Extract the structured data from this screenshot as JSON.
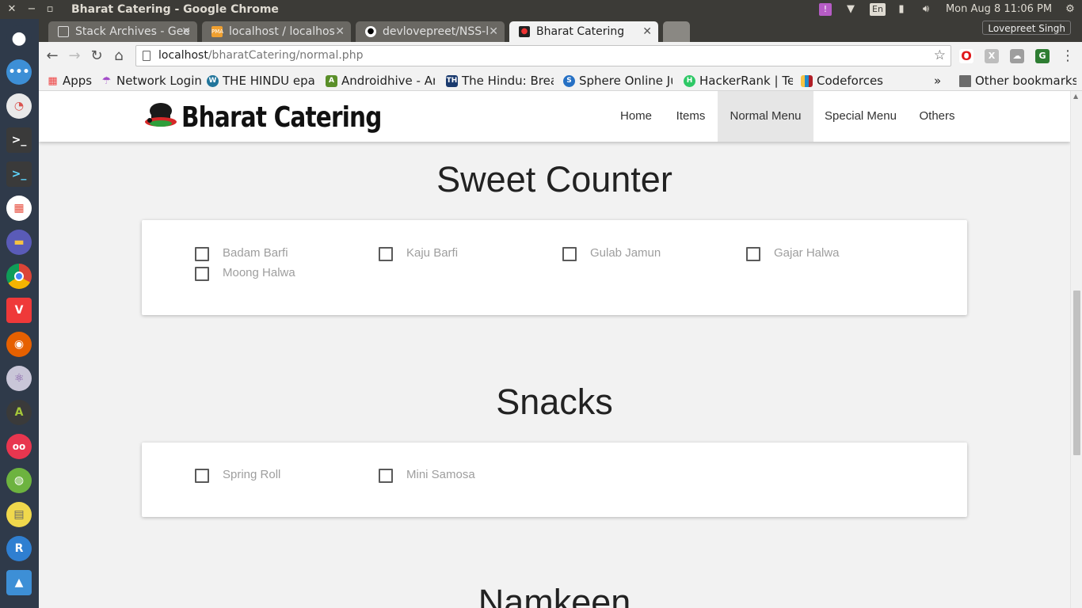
{
  "system": {
    "window_title": "Bharat Catering - Google Chrome",
    "clock": "Mon Aug  8 11:06 PM",
    "keyboard_layout": "En"
  },
  "browser": {
    "tabs": [
      {
        "label": "Stack Archives - Gee",
        "icon": "page-icon",
        "active": false
      },
      {
        "label": "localhost / localhos",
        "icon": "phpmyadmin-icon",
        "active": false
      },
      {
        "label": "devlovepreet/NSS-l",
        "icon": "github-icon",
        "active": false
      },
      {
        "label": "Bharat Catering",
        "icon": "chef-icon",
        "active": true
      }
    ],
    "profile_name": "Lovepreet Singh",
    "url_host": "localhost",
    "url_path": "/bharatCatering/normal.php",
    "bookmarks": [
      {
        "label": "Apps",
        "icon": "apps-grid-icon"
      },
      {
        "label": "Network Login",
        "icon": "umbrella-icon"
      },
      {
        "label": "THE HINDU epap",
        "icon": "wordpress-icon"
      },
      {
        "label": "Androidhive - An",
        "icon": "androidhive-icon"
      },
      {
        "label": "The Hindu: Break",
        "icon": "the-hindu-icon"
      },
      {
        "label": "Sphere Online Ju",
        "icon": "spoj-icon"
      },
      {
        "label": "HackerRank | Tec",
        "icon": "hackerrank-icon"
      },
      {
        "label": "Codeforces",
        "icon": "codeforces-icon"
      }
    ],
    "overflow_label": "»",
    "other_bookmarks": "Other bookmarks"
  },
  "site": {
    "brand": "Bharat Catering",
    "nav": [
      {
        "label": "Home",
        "active": false
      },
      {
        "label": "Items",
        "active": false
      },
      {
        "label": "Normal Menu",
        "active": true
      },
      {
        "label": "Special Menu",
        "active": false
      },
      {
        "label": "Others",
        "active": false
      }
    ],
    "sections": [
      {
        "title": "Sweet Counter",
        "items": [
          "Badam Barfi",
          "Kaju Barfi",
          "Gulab Jamun",
          "Gajar Halwa",
          "Moong Halwa"
        ]
      },
      {
        "title": "Snacks",
        "items": [
          "Spring Roll",
          "Mini Samosa"
        ]
      },
      {
        "title": "Namkeen",
        "items": []
      }
    ]
  },
  "colors": {
    "ubuntu_panel": "#3c3b37",
    "launcher": "#2f3a4a",
    "nav_active_bg": "#e6e6e6",
    "item_text": "#9e9e9e",
    "checkbox_border": "#5a5a5a"
  }
}
